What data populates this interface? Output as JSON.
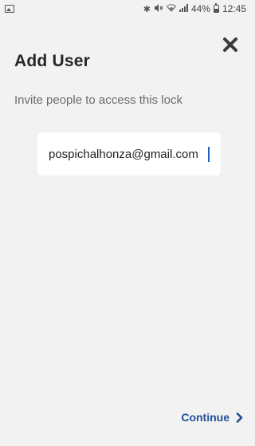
{
  "status_bar": {
    "battery_percent": "44%",
    "time": "12:45",
    "icons": [
      "image-icon",
      "bluetooth-icon",
      "mute-icon",
      "wifi-icon",
      "signal-icon",
      "battery-icon"
    ]
  },
  "header": {
    "close_icon": "close-icon",
    "title": "Add User",
    "subtitle": "Invite people to access this lock"
  },
  "form": {
    "email_value": "pospichalhonza@gmail.com"
  },
  "footer": {
    "continue_label": "Continue",
    "continue_icon": "chevron-right-icon"
  },
  "colors": {
    "background": "#f2f2f2",
    "accent": "#1f4e96",
    "title": "#262626",
    "subtitle": "#6b6b6b"
  }
}
